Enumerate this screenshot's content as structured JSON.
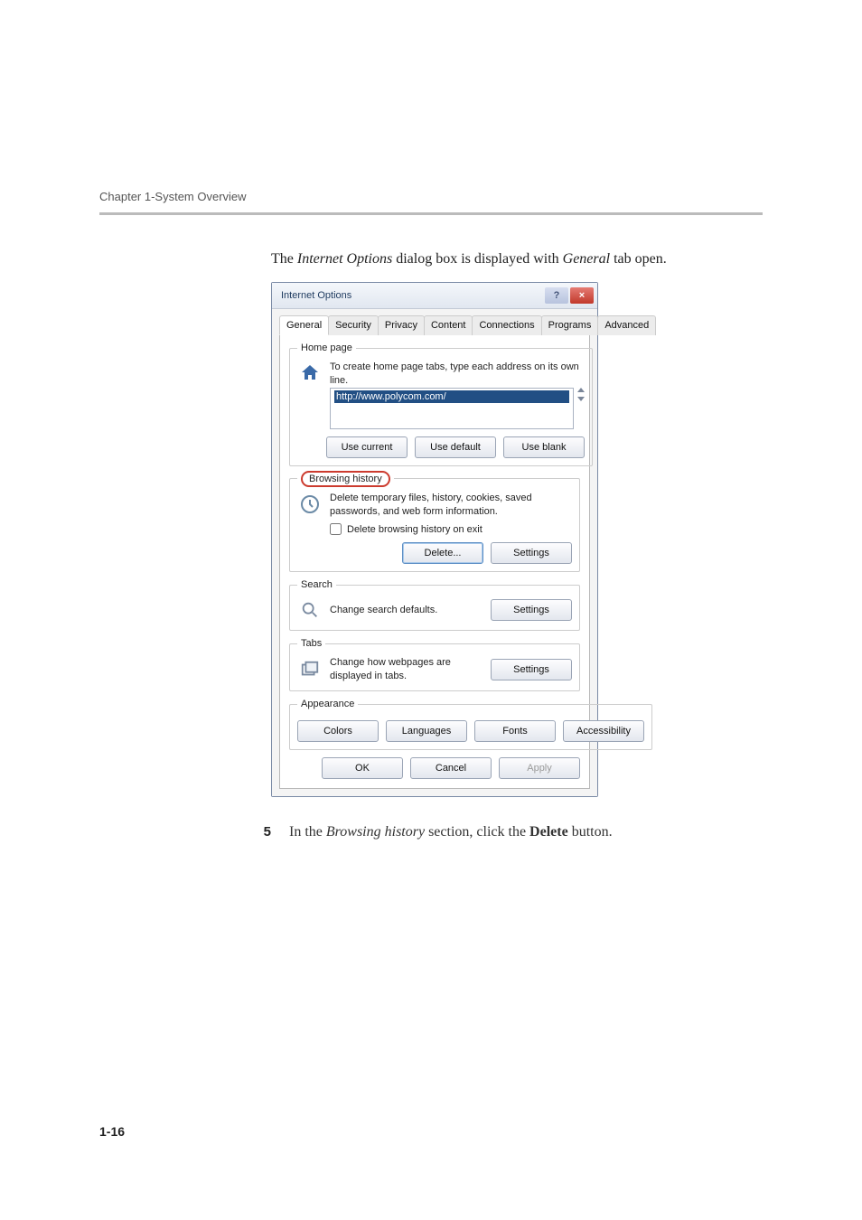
{
  "header": {
    "chapter": "Chapter 1-System Overview"
  },
  "intro": {
    "pre": "The ",
    "i1": "Internet Options",
    "mid": " dialog box is displayed with ",
    "i2": "General",
    "post": " tab open."
  },
  "dialog": {
    "title": "Internet Options",
    "helpBtn": "?",
    "closeBtn": "×",
    "tabs": {
      "general": "General",
      "security": "Security",
      "privacy": "Privacy",
      "content": "Content",
      "connections": "Connections",
      "programs": "Programs",
      "advanced": "Advanced"
    },
    "home": {
      "legend": "Home page",
      "desc": "To create home page tabs, type each address on its own line.",
      "url": "http://www.polycom.com/",
      "useCurrent": "Use current",
      "useDefault": "Use default",
      "useBlank": "Use blank"
    },
    "bh": {
      "legend": "Browsing history",
      "desc": "Delete temporary files, history, cookies, saved passwords, and web form information.",
      "chk": "Delete browsing history on exit",
      "delete": "Delete...",
      "settings": "Settings"
    },
    "search": {
      "legend": "Search",
      "desc": "Change search defaults.",
      "settings": "Settings"
    },
    "tabsGroup": {
      "legend": "Tabs",
      "desc": "Change how webpages are displayed in tabs.",
      "settings": "Settings"
    },
    "appearance": {
      "legend": "Appearance",
      "colors": "Colors",
      "languages": "Languages",
      "fonts": "Fonts",
      "access": "Accessibility"
    },
    "footer": {
      "ok": "OK",
      "cancel": "Cancel",
      "apply": "Apply"
    }
  },
  "step5": {
    "num": "5",
    "pre": "In the ",
    "i1": "Browsing history",
    "mid": " section, click the ",
    "b1": "Delete",
    "post": " button."
  },
  "pageNum": "1-16"
}
